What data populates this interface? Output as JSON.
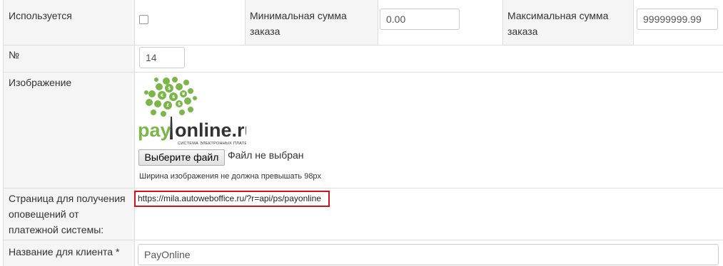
{
  "form": {
    "used": {
      "label": "Используется",
      "checked": false
    },
    "min_order": {
      "label": "Минимальная сумма заказа",
      "value": "0.00"
    },
    "max_order": {
      "label": "Максимальная сумма заказа",
      "value": "99999999.99"
    },
    "number": {
      "label": "№",
      "value": "14"
    },
    "image": {
      "label": "Изображение",
      "logo_text": "payonline.ru",
      "logo_tagline": "СИСТЕМА ЭЛЕКТРОННЫХ ПЛАТЕЖЕЙ",
      "choose_file_button": "Выберите файл",
      "no_file_text": "Файл не выбран",
      "hint": "Ширина изображения не должна превышать 98px"
    },
    "notification_page": {
      "label": "Страница для получения оповещений от платежной системы:",
      "url": "https://mila.autoweboffice.ru/?r=api/ps/payonline"
    },
    "client_name": {
      "label": "Название для клиента *",
      "value": "PayOnline"
    }
  },
  "colors": {
    "label_bg": "#f5f5f5",
    "border": "#dddddd",
    "highlight": "#d0121a",
    "logo_green": "#7ab648"
  }
}
